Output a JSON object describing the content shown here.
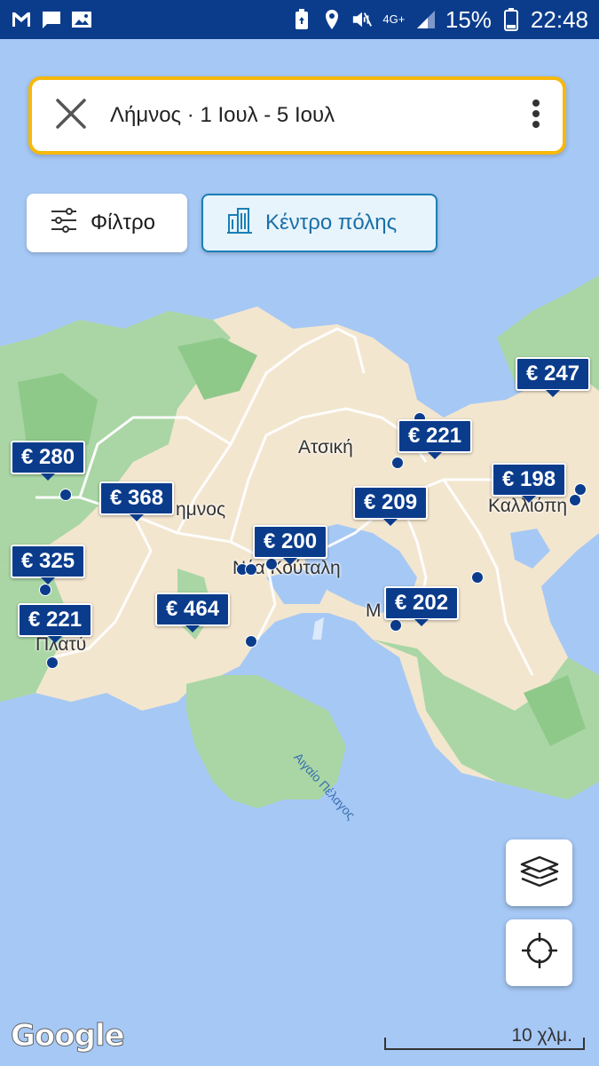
{
  "status_bar": {
    "network_label_top": "4G+",
    "battery": "15%",
    "time": "22:48",
    "icons": [
      "gmail-icon",
      "message-icon",
      "image-icon",
      "battery-saver-icon",
      "location-icon",
      "mute-icon",
      "signal-icon",
      "battery-icon"
    ]
  },
  "search": {
    "query": "Λήμνος · 1 Ιουλ - 5 Ιουλ",
    "accent_color": "#f6b80a"
  },
  "chips": {
    "filter_label": "Φίλτρο",
    "center_label": "Κέντρο πόλης"
  },
  "pins": [
    {
      "id": "pin-247",
      "price": "€ 247"
    },
    {
      "id": "pin-221-atsiki",
      "price": "€ 221"
    },
    {
      "id": "pin-280",
      "price": "€ 280"
    },
    {
      "id": "pin-198",
      "price": "€ 198"
    },
    {
      "id": "pin-368",
      "price": "€ 368"
    },
    {
      "id": "pin-209",
      "price": "€ 209"
    },
    {
      "id": "pin-200",
      "price": "€ 200"
    },
    {
      "id": "pin-325",
      "price": "€ 325"
    },
    {
      "id": "pin-202",
      "price": "€ 202"
    },
    {
      "id": "pin-464",
      "price": "€ 464"
    },
    {
      "id": "pin-221-platy",
      "price": "€ 221"
    }
  ],
  "places": {
    "atsiki": "Ατσική",
    "kalliopi": "Καλλιόπη",
    "myrina": "ημνος",
    "nea_koutali": "Νέα Κούταλη",
    "moudros": "Μ",
    "platy": "Πλατύ",
    "sea": "Αιγαίο Πέλαγος"
  },
  "map": {
    "provider": "Google",
    "scale": "10 χλμ.",
    "land_color": "#f3e6cf",
    "green_color": "#a9d6a4",
    "water_color": "#a6c8f5",
    "pin_color": "#0b3c8c"
  }
}
